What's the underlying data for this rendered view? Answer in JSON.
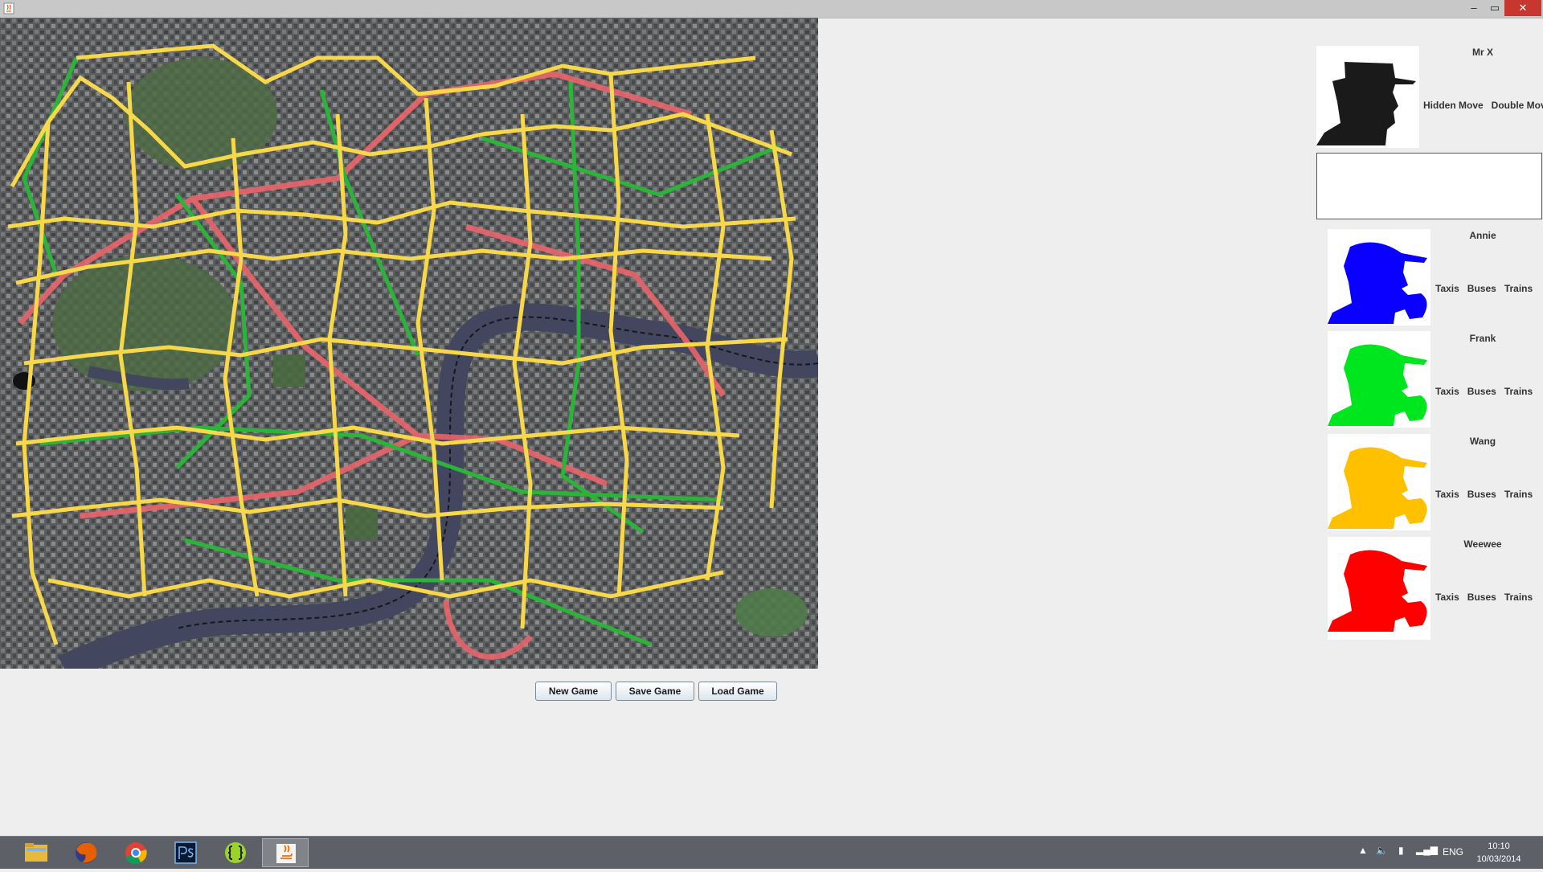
{
  "window": {
    "minimize": "–",
    "maximize": "▭",
    "close": "✕"
  },
  "map": {
    "icon": "scotland-yard-board-map"
  },
  "controls": {
    "new_game": "New Game",
    "save_game": "Save Game",
    "load_game": "Load Game"
  },
  "mrx": {
    "name": "Mr X",
    "hidden_move": "Hidden Move",
    "double_move": "Double Move",
    "color": "#1a1a1a",
    "log_text": ""
  },
  "detectives": [
    {
      "name": "Annie",
      "taxis": "Taxis",
      "buses": "Buses",
      "trains": "Trains",
      "color": "#0a00ff"
    },
    {
      "name": "Frank",
      "taxis": "Taxis",
      "buses": "Buses",
      "trains": "Trains",
      "color": "#00e61e"
    },
    {
      "name": "Wang",
      "taxis": "Taxis",
      "buses": "Buses",
      "trains": "Trains",
      "color": "#ffc000"
    },
    {
      "name": "Weewee",
      "taxis": "Taxis",
      "buses": "Buses",
      "trains": "Trains",
      "color": "#ff0000"
    }
  ],
  "taskbar": {
    "apps": [
      "folder-icon",
      "firefox-icon",
      "chrome-icon",
      "photoshop-icon",
      "brackets-icon",
      "java-icon"
    ],
    "language": "ENG",
    "time": "10:10",
    "date": "10/03/2014"
  }
}
